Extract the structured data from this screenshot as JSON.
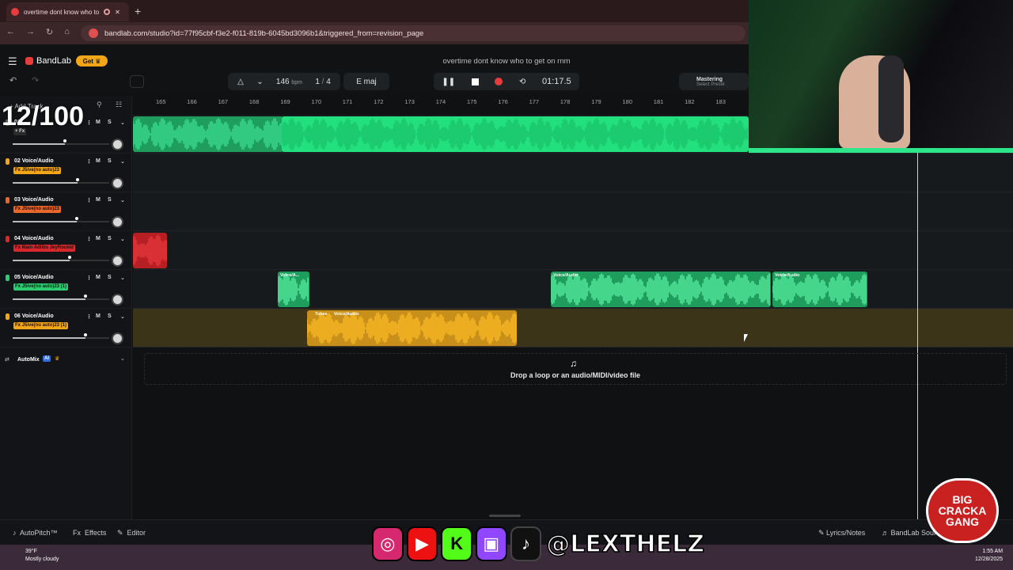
{
  "browser": {
    "tab_title": "overtime dont know who to",
    "new_tab": "+",
    "url": "bandlab.com/studio?id=77f95cbf-f3e2-f011-819b-6045bd3096b1&triggered_from=revision_page"
  },
  "header": {
    "logo": "BandLab",
    "get_label": "Get",
    "project_title": "overtime dont know who to get on rnm"
  },
  "toolbar": {
    "bpm": "146",
    "bpm_unit": "bpm",
    "time_sig_num": "1",
    "time_sig_den": "4",
    "key": "E maj",
    "time": "01:17.5",
    "mastering": "Mastering",
    "mastering_sub": "Select Preset"
  },
  "ruler": [
    "165",
    "166",
    "167",
    "168",
    "169",
    "170",
    "171",
    "172",
    "173",
    "174",
    "175",
    "176",
    "177",
    "178",
    "179",
    "180",
    "181",
    "182",
    "183"
  ],
  "sidebar": {
    "add_track": "Add Track",
    "overlay_counter": "12/100",
    "automix": "AutoMix",
    "ai_badge": "AI"
  },
  "tracks": [
    {
      "name": "01",
      "fx": "+ Fx",
      "fx_color": "#2b2b2b",
      "mic_color": "#888888",
      "level": 0.54
    },
    {
      "name": "02 Voice/Audio",
      "fx": "Fx J5ive(no auto)23",
      "fx_color": "#f2a516",
      "mic_color": "#f2a516",
      "level": 0.67
    },
    {
      "name": "03 Voice/Audio",
      "fx": "Fx J5ive(no auto)23",
      "fx_color": "#e8672a",
      "mic_color": "#e8672a",
      "level": 0.66
    },
    {
      "name": "04 Voice/Audio",
      "fx": "Fx Main Adlibs JeyRockid",
      "fx_color": "#d9282c",
      "mic_color": "#d9282c",
      "level": 0.59
    },
    {
      "name": "05 Voice/Audio",
      "fx": "Fx J5ive(no auto)23 (1)",
      "fx_color": "#2ecc71",
      "mic_color": "#2ecc71",
      "level": 0.75
    },
    {
      "name": "06 Voice/Audio",
      "fx": "Fx J5ive(no auto)23 (1)",
      "fx_color": "#f2a516",
      "mic_color": "#f2a516",
      "level": 0.75
    }
  ],
  "track_buttons": {
    "mute": "M",
    "solo": "S"
  },
  "clips": {
    "t5a": "Voice/A...",
    "t5b": "Voice/Audio",
    "t5c": "Voice/Audio",
    "t6_tag": "Tokes",
    "t6": "Voice/Audio"
  },
  "drop_zone": "Drop a loop or an audio/MIDI/video file",
  "bottom": {
    "autopitch": "AutoPitch™",
    "effects": "Effects",
    "editor": "Editor",
    "lyrics": "Lyrics/Notes",
    "bandlab_sounds": "BandLab Sounds"
  },
  "taskbar": {
    "weather_temp": "39°F",
    "weather_desc": "Mostly cloudy",
    "time": "1:55 AM",
    "date": "12/28/2025"
  },
  "overlay": {
    "handle": "@LEXTHELZ",
    "sticker_line1": "BIG",
    "sticker_line2": "CRACKA",
    "sticker_line3": "GANG"
  },
  "colors": {
    "accent_green": "#2ee68a",
    "accent_orange": "#f2a516",
    "record_red": "#e63c3c"
  }
}
